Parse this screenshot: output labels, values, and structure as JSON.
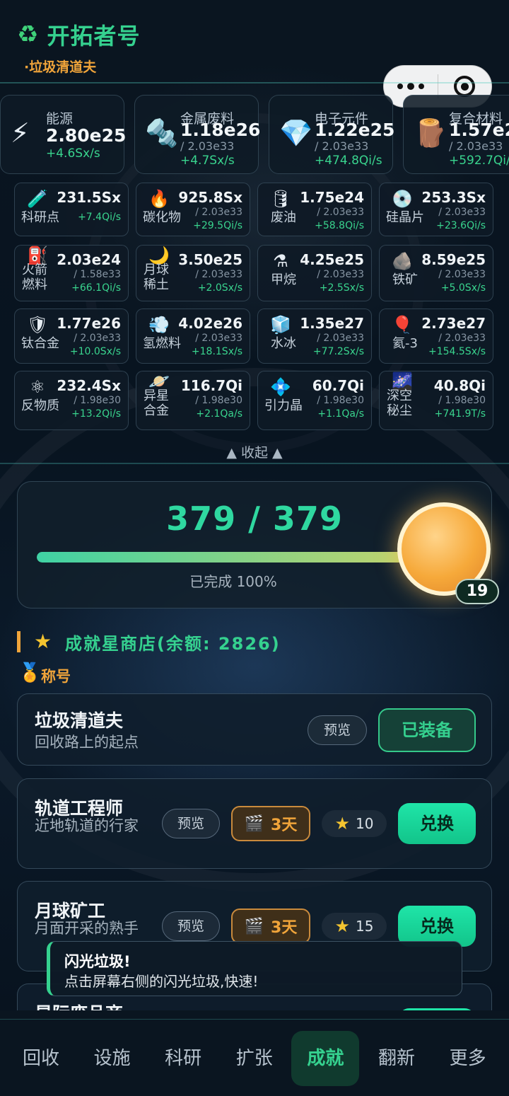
{
  "header": {
    "title": "开拓者号",
    "title_icon": "recycle-icon",
    "subtitle": "·垃圾清道夫"
  },
  "capsule": {
    "more_icon": "more-dots-icon",
    "close_icon": "target-close-icon"
  },
  "top_resources": [
    {
      "icon": "lightning-icon",
      "glyph": "⚡",
      "name": "能源",
      "value": "2.80e25",
      "cap": "",
      "rate": "+4.6Sx/s"
    },
    {
      "icon": "screw-icon",
      "glyph": "🔩",
      "name": "金属废料",
      "value": "1.18e26",
      "cap": "/ 2.03e33",
      "rate": "+4.7Sx/s"
    },
    {
      "icon": "diamond-icon",
      "glyph": "💎",
      "name": "电子元件",
      "value": "1.22e25",
      "cap": "/ 2.03e33",
      "rate": "+474.8Qi/s"
    },
    {
      "icon": "wood-icon",
      "glyph": "🪵",
      "name": "复合材料",
      "value": "1.57e2",
      "cap": "/ 2.03e33",
      "rate": "+592.7Qi/"
    }
  ],
  "resources": [
    {
      "icon": "test-tube-icon",
      "glyph": "🧪",
      "name": "科研点",
      "value": "231.5Sx",
      "cap": "",
      "rate": "+7.4Qi/s"
    },
    {
      "icon": "fire-icon",
      "glyph": "🔥",
      "name": "碳化物",
      "value": "925.8Sx",
      "cap": "/ 2.03e33",
      "rate": "+29.5Qi/s"
    },
    {
      "icon": "barrel-icon",
      "glyph": "🛢",
      "name": "废油",
      "value": "1.75e24",
      "cap": "/ 2.03e33",
      "rate": "+58.8Qi/s"
    },
    {
      "icon": "disc-icon",
      "glyph": "💿",
      "name": "硅晶片",
      "value": "253.3Sx",
      "cap": "/ 2.03e33",
      "rate": "+23.6Qi/s"
    },
    {
      "icon": "fuel-pump-icon",
      "glyph": "⛽",
      "name": "火箭燃料",
      "value": "2.03e24",
      "cap": "/ 1.58e33",
      "rate": "+66.1Qi/s"
    },
    {
      "icon": "moon-icon",
      "glyph": "🌙",
      "name": "月球稀土",
      "value": "3.50e25",
      "cap": "/ 2.03e33",
      "rate": "+2.0Sx/s"
    },
    {
      "icon": "flask-icon",
      "glyph": "⚗",
      "name": "甲烷",
      "value": "4.25e25",
      "cap": "/ 2.03e33",
      "rate": "+2.5Sx/s"
    },
    {
      "icon": "rock-icon",
      "glyph": "🪨",
      "name": "铁矿",
      "value": "8.59e25",
      "cap": "/ 2.03e33",
      "rate": "+5.0Sx/s"
    },
    {
      "icon": "shield-icon",
      "glyph": "🛡",
      "name": "钛合金",
      "value": "1.77e26",
      "cap": "/ 2.03e33",
      "rate": "+10.0Sx/s"
    },
    {
      "icon": "dash-cloud-icon",
      "glyph": "💨",
      "name": "氢燃料",
      "value": "4.02e26",
      "cap": "/ 2.03e33",
      "rate": "+18.1Sx/s"
    },
    {
      "icon": "ice-icon",
      "glyph": "🧊",
      "name": "水冰",
      "value": "1.35e27",
      "cap": "/ 2.03e33",
      "rate": "+77.2Sx/s"
    },
    {
      "icon": "balloon-icon",
      "glyph": "🎈",
      "name": "氦-3",
      "value": "2.73e27",
      "cap": "/ 2.03e33",
      "rate": "+154.5Sx/s"
    },
    {
      "icon": "atom-icon",
      "glyph": "⚛",
      "name": "反物质",
      "value": "232.4Sx",
      "cap": "/ 1.98e30",
      "rate": "+13.2Qi/s"
    },
    {
      "icon": "planet-icon",
      "glyph": "🪐",
      "name": "异星合金",
      "value": "116.7Qi",
      "cap": "/ 1.98e30",
      "rate": "+2.1Qa/s"
    },
    {
      "icon": "crystal-icon",
      "glyph": "💠",
      "name": "引力晶",
      "value": "60.7Qi",
      "cap": "/ 1.98e30",
      "rate": "+1.1Qa/s"
    },
    {
      "icon": "galaxy-icon",
      "glyph": "🌌",
      "name": "深空秘尘",
      "value": "40.8Qi",
      "cap": "/ 1.98e30",
      "rate": "+741.9T/s"
    }
  ],
  "collapse_label": "▲ 收起 ▲",
  "progress": {
    "text": "379 / 379",
    "completed": 379,
    "total": 379,
    "fraction": 1.0,
    "percent_label": "已完成 100%",
    "level": "19"
  },
  "shop": {
    "title": "成就星商店(余额: 2826)",
    "star_icon": "star-icon",
    "section_icon": "medal-icon",
    "section_title": "称号"
  },
  "titles": [
    {
      "name": "垃圾清道夫",
      "desc": "回收路上的起点",
      "preview": "预览",
      "status": "已装备"
    },
    {
      "name": "轨道工程师",
      "desc": "近地轨道的行家",
      "preview": "预览",
      "duration": "3天",
      "clapper_icon": "clapper-icon",
      "price": "10",
      "action": "兑换"
    },
    {
      "name": "月球矿工",
      "desc": "月面开采的熟手",
      "preview": "预览",
      "duration": "3天",
      "clapper_icon": "clapper-icon",
      "price": "15",
      "action": "兑换"
    },
    {
      "name": "星际废品商"
    }
  ],
  "toast": {
    "title": "闪光垃圾!",
    "body": "点击屏幕右侧的闪光垃圾,快速!"
  },
  "nav": {
    "items": [
      "回收",
      "设施",
      "科研",
      "扩张",
      "成就",
      "翻新",
      "更多"
    ],
    "active": "成就"
  },
  "colors": {
    "accent": "#35d18f",
    "orange": "#f0a43a",
    "rate_green": "#39d48e",
    "bg": "#060d16"
  }
}
